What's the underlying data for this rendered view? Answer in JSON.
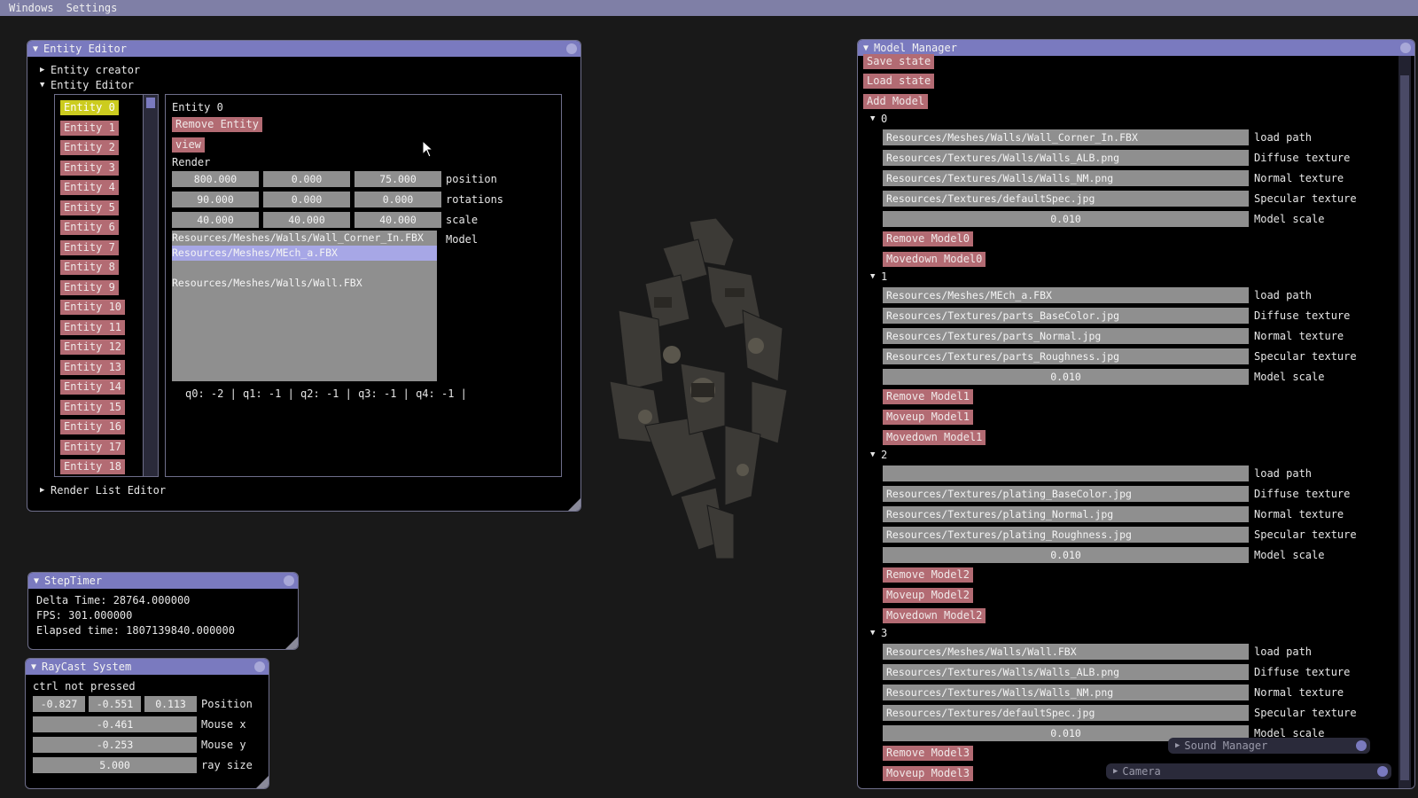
{
  "menubar": {
    "items": [
      "Windows",
      "Settings"
    ]
  },
  "entity_editor": {
    "title": "Entity Editor",
    "tree_creator": "Entity creator",
    "tree_editor": "Entity Editor",
    "tree_render_list": "Render List Editor",
    "entities": [
      "Entity 0",
      "Entity 1",
      "Entity 2",
      "Entity 3",
      "Entity 4",
      "Entity 5",
      "Entity 6",
      "Entity 7",
      "Entity 8",
      "Entity 9",
      "Entity 10",
      "Entity 11",
      "Entity 12",
      "Entity 13",
      "Entity 14",
      "Entity 15",
      "Entity 16",
      "Entity 17",
      "Entity 18"
    ],
    "selected_entity": "Entity 0",
    "detail": {
      "name": "Entity 0",
      "remove_label": "Remove Entity",
      "view_label": "view",
      "render_label": "Render",
      "position": [
        "800.000",
        "0.000",
        "75.000"
      ],
      "position_label": "position",
      "rotations": [
        "90.000",
        "0.000",
        "0.000"
      ],
      "rotations_label": "rotations",
      "scale": [
        "40.000",
        "40.000",
        "40.000"
      ],
      "scale_label": "scale",
      "model_label": "Model",
      "models": [
        "Resources/Meshes/Walls/Wall_Corner_In.FBX",
        "Resources/Meshes/MEch_a.FBX",
        "",
        "Resources/Meshes/Walls/Wall.FBX"
      ],
      "selected_model_index": 1,
      "queue_text": "q0: -2 | q1: -1 | q2: -1 | q3: -1 | q4: -1 |"
    }
  },
  "model_manager": {
    "title": "Model Manager",
    "save_label": "Save state",
    "load_label": "Load state",
    "add_label": "Add Model",
    "labels": {
      "load_path": "load path",
      "diffuse": "Diffuse texture",
      "normal": "Normal texture",
      "specular": "Specular texture",
      "scale": "Model scale"
    },
    "models": [
      {
        "id": "0",
        "load_path": "Resources/Meshes/Walls/Wall_Corner_In.FBX",
        "diffuse": "Resources/Textures/Walls/Walls_ALB.png",
        "normal": "Resources/Textures/Walls/Walls_NM.png",
        "specular": "Resources/Textures/defaultSpec.jpg",
        "scale": "0.010",
        "buttons": [
          "Remove Model0",
          "Movedown Model0"
        ]
      },
      {
        "id": "1",
        "load_path": "Resources/Meshes/MEch_a.FBX",
        "diffuse": "Resources/Textures/parts_BaseColor.jpg",
        "normal": "Resources/Textures/parts_Normal.jpg",
        "specular": "Resources/Textures/parts_Roughness.jpg",
        "scale": "0.010",
        "buttons": [
          "Remove Model1",
          "Moveup Model1",
          "Movedown Model1"
        ]
      },
      {
        "id": "2",
        "load_path": "",
        "diffuse": "Resources/Textures/plating_BaseColor.jpg",
        "normal": "Resources/Textures/plating_Normal.jpg",
        "specular": "Resources/Textures/plating_Roughness.jpg",
        "scale": "0.010",
        "buttons": [
          "Remove Model2",
          "Moveup Model2",
          "Movedown Model2"
        ]
      },
      {
        "id": "3",
        "load_path": "Resources/Meshes/Walls/Wall.FBX",
        "diffuse": "Resources/Textures/Walls/Walls_ALB.png",
        "normal": "Resources/Textures/Walls/Walls_NM.png",
        "specular": "Resources/Textures/defaultSpec.jpg",
        "scale": "0.010",
        "buttons": [
          "Remove Model3",
          "Moveup Model3"
        ]
      }
    ]
  },
  "steptimer": {
    "title": "StepTimer",
    "delta": "Delta Time: 28764.000000",
    "fps": "FPS: 301.000000",
    "elapsed": "Elapsed time: 1807139840.000000"
  },
  "raycast": {
    "title": "RayCast System",
    "status": "ctrl not pressed",
    "position": [
      "-0.827",
      "-0.551",
      "0.113"
    ],
    "position_label": "Position",
    "mouse_x": "-0.461",
    "mouse_x_label": "Mouse x",
    "mouse_y": "-0.253",
    "mouse_y_label": "Mouse y",
    "ray_size": "5.000",
    "ray_size_label": "ray size"
  },
  "sound_manager": {
    "title": "Sound Manager"
  },
  "camera": {
    "title": "Camera"
  },
  "colors": {
    "title_bar": "#7a7abf",
    "button": "#b36b73",
    "selected": "#cccc1f",
    "field": "#8f8f8f",
    "menubar": "#7f7fa6"
  }
}
